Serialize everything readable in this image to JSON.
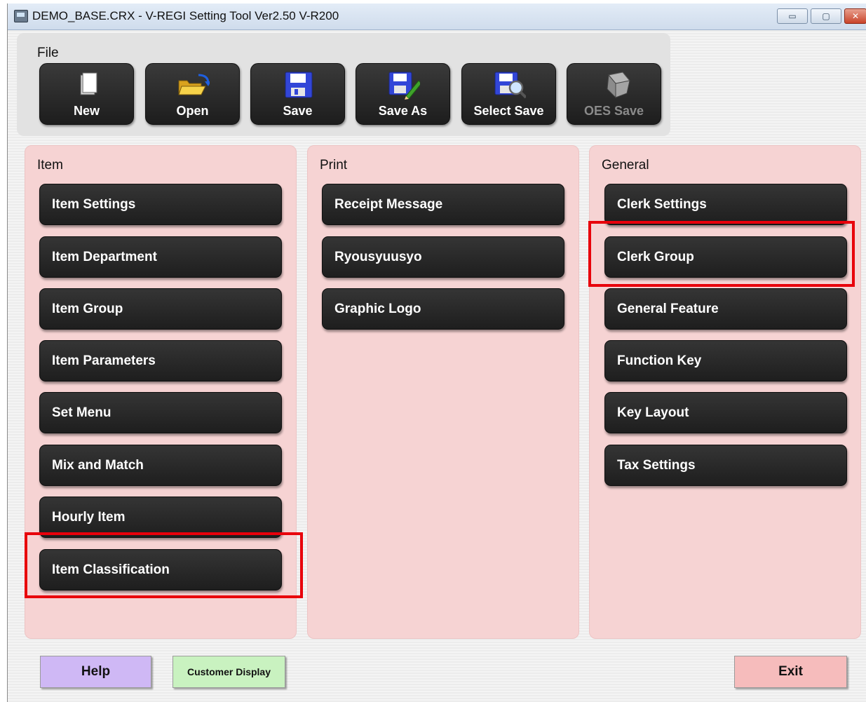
{
  "window": {
    "title": "DEMO_BASE.CRX - V-REGI Setting Tool Ver2.50 V-R200",
    "controls": {
      "minimize": "▭",
      "maximize": "▢",
      "close": "✕"
    }
  },
  "file_panel": {
    "title": "File",
    "buttons": [
      {
        "label": "New",
        "icon": "new-document-icon"
      },
      {
        "label": "Open",
        "icon": "open-folder-icon"
      },
      {
        "label": "Save",
        "icon": "floppy-disk-icon"
      },
      {
        "label": "Save As",
        "icon": "floppy-disk-pencil-icon"
      },
      {
        "label": "Select Save",
        "icon": "floppy-disk-magnifier-icon"
      },
      {
        "label": "OES Save",
        "icon": "oes-package-icon",
        "disabled": true
      }
    ]
  },
  "sections": {
    "item": {
      "title": "Item",
      "buttons": [
        "Item Settings",
        "Item Department",
        "Item Group",
        "Item Parameters",
        "Set Menu",
        "Mix and Match",
        "Hourly Item",
        "Item Classification"
      ]
    },
    "print": {
      "title": "Print",
      "buttons": [
        "Receipt Message",
        "Ryousyuusyo",
        "Graphic Logo"
      ]
    },
    "general": {
      "title": "General",
      "buttons": [
        "Clerk Settings",
        "Clerk Group",
        "General Feature",
        "Function Key",
        "Key Layout",
        "Tax Settings"
      ]
    }
  },
  "highlights": [
    "Item Classification",
    "Clerk Group"
  ],
  "bottom_buttons": {
    "help": {
      "label": "Help",
      "color": "#cfb8f5"
    },
    "customer_display": {
      "label": "Customer Display",
      "color": "#c9f2c0"
    },
    "exit": {
      "label": "Exit",
      "color": "#f6bcbc"
    }
  },
  "colors": {
    "section_bg": "#f6d3d3",
    "button_bg": "#262626",
    "highlight": "#e8000b"
  }
}
